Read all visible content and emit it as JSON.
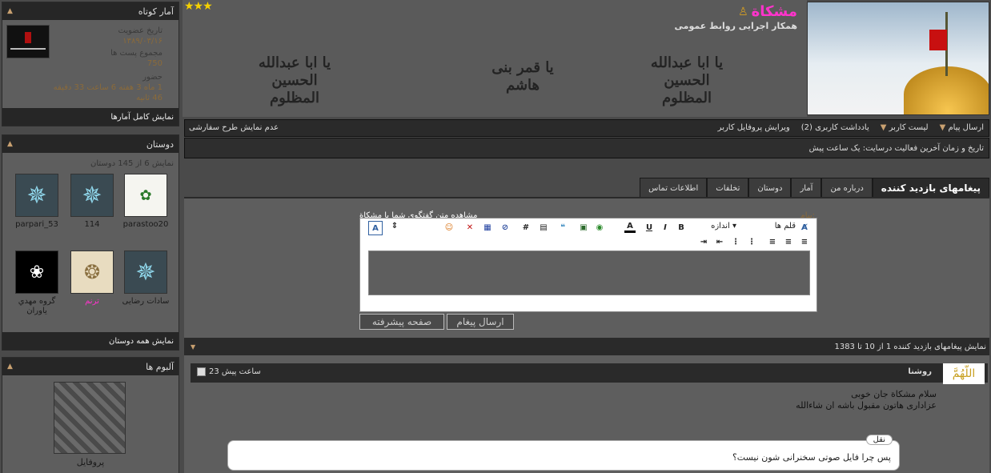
{
  "stats": {
    "header": "آمار کوتاه",
    "join_label": "تاریخ عضویت",
    "join_value": "۱۳۸۹/۰۳/۱۶",
    "posts_label": "مجموع پست ها",
    "posts_value": "750",
    "presence_label": "حضور",
    "presence_value": "1 ماه 3 هفته 6 ساعت 33 دقیقه",
    "presence_value2": "46 ثانیه",
    "footer": "نمایش کامل آمارها"
  },
  "friends": {
    "header": "دوستان",
    "count_text": "نمایش 6 از 145 دوستان",
    "items": [
      {
        "name": "parastoo20"
      },
      {
        "name": "114"
      },
      {
        "name": "parpari_53"
      },
      {
        "name": "سادات رضایی"
      },
      {
        "name": "ترنم"
      },
      {
        "name": "گروه مهدي یاوران"
      }
    ],
    "footer": "نمایش همه دوستان"
  },
  "albums": {
    "header": "آلبوم ها",
    "album_name": "پروفایل"
  },
  "profile": {
    "username": "مشکاة",
    "title": "همکار اجرایی روابط عمومی",
    "stars": "★★★",
    "calligraphy": [
      "یا ابا عبدالله الحسین المظلوم",
      "یا قمر بنی هاشم",
      "یا ابا عبدالله الحسین المظلوم"
    ]
  },
  "actions": {
    "send_message": "ارسال پیام",
    "user_list": "لیست کاربر",
    "user_notes": "یادداشت کاربری (2)",
    "edit_profile": "ویرایش پروفایل کاربر",
    "hide_custom": "عدم نمایش طرح سفارشی",
    "last_activity": "تاریخ و زمان آخرین فعالیت درسایت: یک ساعت پیش"
  },
  "tabs": [
    "پیغامهای بازدید کننده",
    "درباره من",
    "آمار",
    "دوستان",
    "تخلفات",
    "اطلاعات تماس"
  ],
  "composer": {
    "message_label": "پیام:",
    "conversation_link": "مشاهده متن گفتگوی شما با مشکاة",
    "font_label": "قلم ها",
    "size_label": "اندازه",
    "send_button": "ارسال پیغام",
    "advanced_button": "صفحه پیشرفته"
  },
  "messages": {
    "summary": "نمایش پیغامهای بازدید کننده 1 از 10 تا 1383",
    "author": "روشنا",
    "time": "23 ساعت پیش",
    "avatar_text": "اللّهُمَّ",
    "line1": "سلام مشکاة جان خوبی",
    "line2": "عزاداری هاتون مقبول باشه ان شاءالله",
    "quote_label": "نقل",
    "quote_text": "پس چرا فایل صوتی سخنرانی شون نیست؟"
  },
  "colors": {
    "username": "#ff33cc",
    "stars": "#f5d000",
    "caret": "#c8a070",
    "bg": "#4a4a4a"
  }
}
